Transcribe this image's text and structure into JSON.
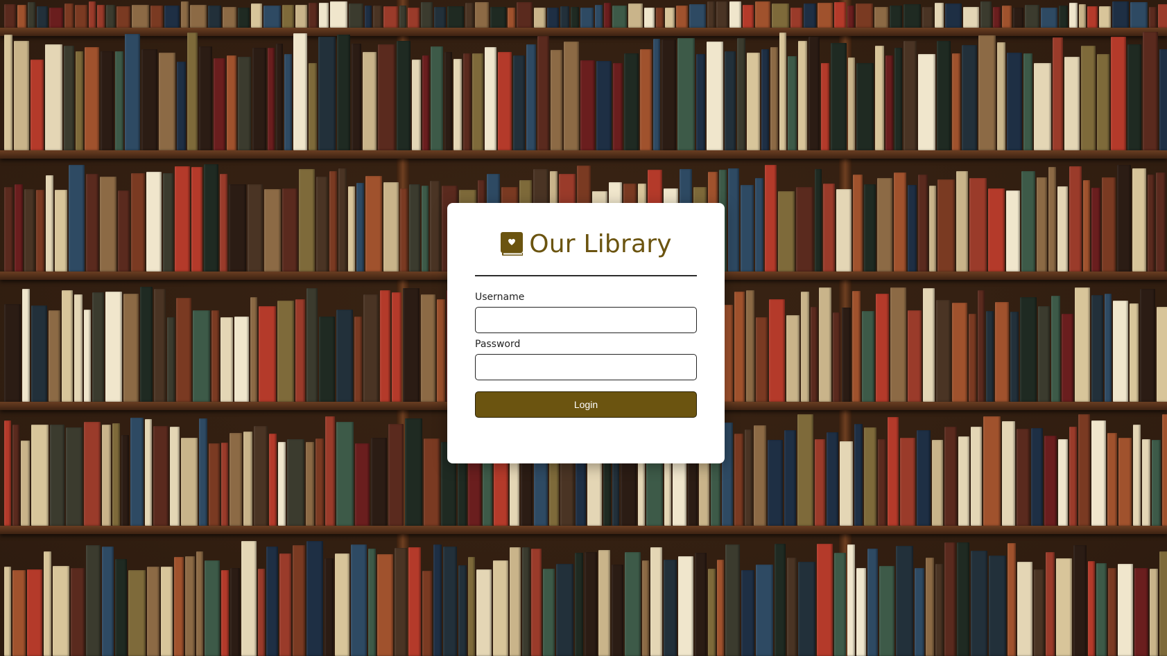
{
  "background": {
    "image": "bookshelf-photo"
  },
  "brand": {
    "icon": "book-heart-icon",
    "title": "Our Library",
    "color": "#6b5410"
  },
  "form": {
    "username_label": "Username",
    "username_value": "",
    "password_label": "Password",
    "password_value": "",
    "submit_label": "Login"
  },
  "colors": {
    "accent": "#6b5410",
    "card_bg": "#ffffff"
  }
}
